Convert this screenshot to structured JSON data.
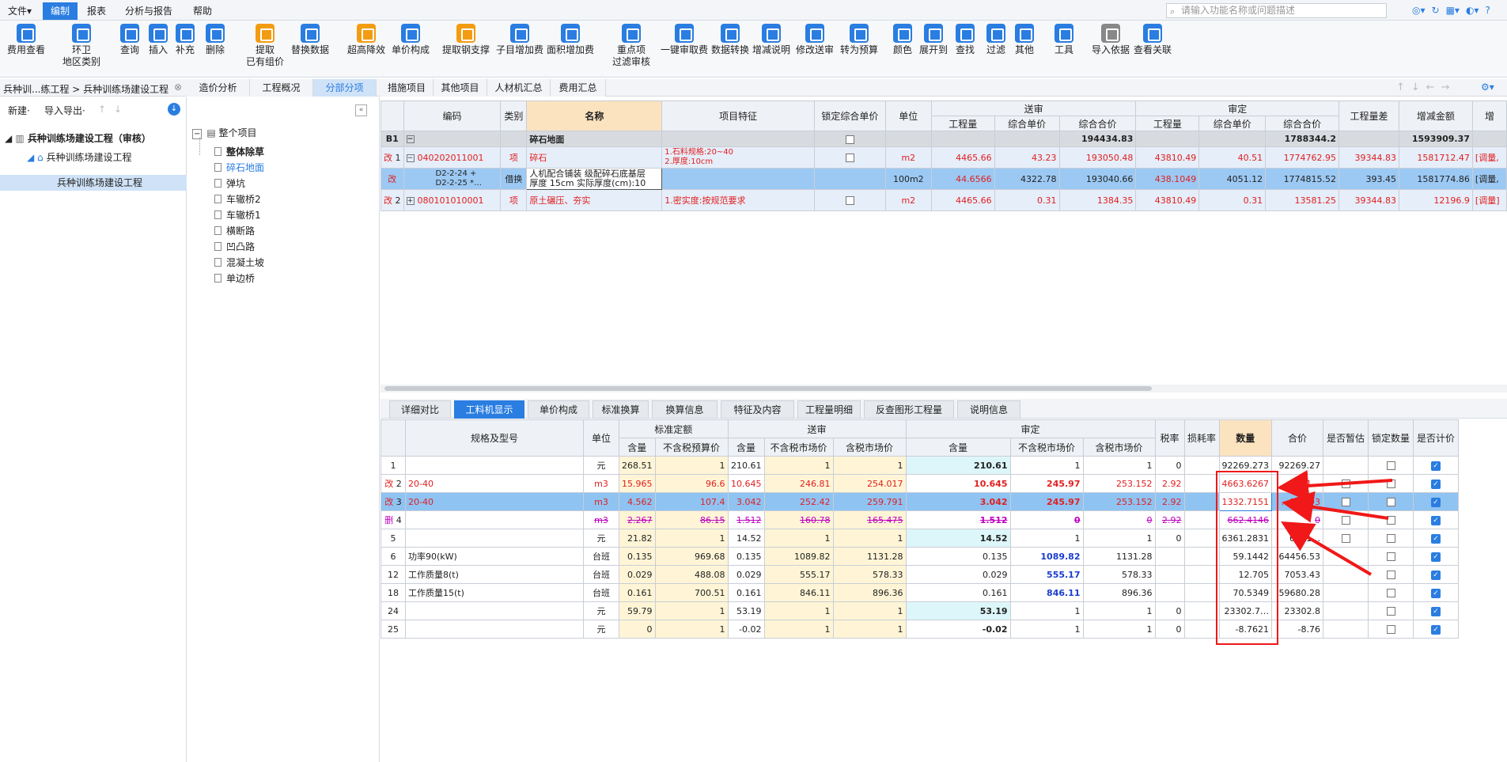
{
  "menubar": {
    "items": [
      "文件",
      "编制",
      "报表",
      "分析与报告",
      "帮助"
    ],
    "search_placeholder": "请输入功能名称或问题描述"
  },
  "ribbon": [
    {
      "label": "费用查看",
      "color": "#2a7de1"
    },
    {
      "label": "环卫",
      "sub": "地区类别",
      "color": "#2a7de1"
    },
    {
      "label": "查询",
      "color": "#2a7de1"
    },
    {
      "label": "插入",
      "color": "#2a7de1"
    },
    {
      "label": "补充",
      "color": "#2a7de1"
    },
    {
      "label": "删除",
      "color": "#2a7de1"
    },
    {
      "label": "提取",
      "sub": "已有组价",
      "color": "#f39c12"
    },
    {
      "label": "替换数据",
      "color": "#2a7de1"
    },
    {
      "label": "超高降效",
      "color": "#f39c12"
    },
    {
      "label": "单价构成",
      "color": "#2a7de1"
    },
    {
      "label": "提取钢支撑",
      "color": "#f39c12"
    },
    {
      "label": "子目增加费",
      "color": "#2a7de1"
    },
    {
      "label": "面积增加费",
      "color": "#2a7de1"
    },
    {
      "label": "重点项",
      "sub": "过滤审核",
      "color": "#2a7de1"
    },
    {
      "label": "一键审取费",
      "color": "#2a7de1"
    },
    {
      "label": "数据转换",
      "color": "#2a7de1"
    },
    {
      "label": "增减说明",
      "color": "#2a7de1"
    },
    {
      "label": "修改送审",
      "color": "#2a7de1"
    },
    {
      "label": "转为预算",
      "color": "#2a7de1"
    },
    {
      "label": "颜色",
      "color": "#2a7de1"
    },
    {
      "label": "展开到",
      "color": "#2a7de1"
    },
    {
      "label": "查找",
      "color": "#2a7de1"
    },
    {
      "label": "过滤",
      "color": "#2a7de1"
    },
    {
      "label": "其他",
      "color": "#2a7de1"
    },
    {
      "label": "工具",
      "color": "#2a7de1"
    },
    {
      "label": "导入依据",
      "color": "#888888"
    },
    {
      "label": "查看关联",
      "color": "#2a7de1"
    }
  ],
  "nav": {
    "breadcrumb": "兵种训...练工程 > 兵种训练场建设工程",
    "tabs": [
      "造价分析",
      "工程概况",
      "分部分项",
      "措施项目",
      "其他项目",
      "人材机汇总",
      "费用汇总"
    ]
  },
  "leftpanel": {
    "new": "新建·",
    "import": "导入导出·",
    "tree": [
      "兵种训练场建设工程（审核）",
      "兵种训练场建设工程",
      "兵种训练场建设工程"
    ]
  },
  "midpanel": {
    "root": "整个项目",
    "items": [
      "整体除草",
      "碎石地面",
      "弹坑",
      "车辙桥2",
      "车辙桥1",
      "横断路",
      "凹凸路",
      "混凝土坡",
      "单边桥"
    ]
  },
  "grid1": {
    "headers": {
      "code": "编码",
      "type": "类别",
      "name": "名称",
      "feature": "项目特征",
      "lock": "锁定综合单价",
      "unit": "单位",
      "sent": "送审",
      "approved": "审定",
      "qty": "工程量",
      "uprice": "综合单价",
      "total": "综合合价",
      "diff": "工程量差",
      "delta": "增减金额",
      "more": "增"
    },
    "b1": {
      "tag": "B1",
      "name": "碎石地面",
      "sent_total": "194434.83",
      "app_total": "1788344.2",
      "delta": "1593909.37"
    },
    "rows": [
      {
        "tag": "改",
        "no": "1",
        "code": "040202011001",
        "type": "项",
        "name": "碎石",
        "feat1": "1.石料规格:20~40",
        "feat2": "2.厚度:10cm",
        "unit": "m2",
        "sq": "4465.66",
        "su": "43.23",
        "st": "193050.48",
        "aq": "43810.49",
        "au": "40.51",
        "at": "1774762.95",
        "dq": "39344.83",
        "delta": "1581712.47",
        "note": "[调量,"
      },
      {
        "tag": "改",
        "code1": "D2-2-24 +",
        "code2": "D2-2-25 *…",
        "type": "借换",
        "name1": "人机配合铺装 级配碎石底基层",
        "name2": "厚度 15cm  实际厚度(cm):10",
        "unit": "100m2",
        "sq": "44.6566",
        "su": "4322.78",
        "st": "193040.66",
        "aq": "438.1049",
        "au": "4051.12",
        "at": "1774815.52",
        "dq": "393.45",
        "delta": "1581774.86",
        "note": "[调量,"
      },
      {
        "tag": "改",
        "no": "2",
        "code": "080101010001",
        "type": "项",
        "name": "原土碾压、夯实",
        "feat1": "1.密实度:按规范要求",
        "unit": "m2",
        "sq": "4465.66",
        "su": "0.31",
        "st": "1384.35",
        "aq": "43810.49",
        "au": "0.31",
        "at": "13581.25",
        "dq": "39344.83",
        "delta": "12196.9",
        "note": "[调量]"
      }
    ]
  },
  "btabs": [
    "详细对比",
    "工料机显示",
    "单价构成",
    "标准换算",
    "换算信息",
    "特征及内容",
    "工程量明细",
    "反查图形工程量",
    "说明信息"
  ],
  "grid2": {
    "headers": {
      "spec": "规格及型号",
      "unit": "单位",
      "std": "标准定额",
      "sent": "送审",
      "app": "审定",
      "content": "含量",
      "notax_budget": "不含税预算价",
      "notax_market": "不含税市场价",
      "tax_market": "含税市场价",
      "rate": "税率",
      "loss": "损耗率",
      "qty": "数量",
      "total": "合价",
      "temp": "是否暂估",
      "lockq": "锁定数量",
      "count": "是否计价"
    },
    "rows": [
      {
        "tag": "",
        "no": "1",
        "spec": "",
        "unit": "元",
        "c1": "268.51",
        "p1": "1",
        "c2": "210.61",
        "p2": "1",
        "p3": "1",
        "c3": "210.61",
        "p4": "1",
        "p5": "1",
        "rate": "0",
        "loss": "",
        "qty": "92269.273",
        "total": "92269.27"
      },
      {
        "tag": "改",
        "no": "2",
        "spec": "20-40",
        "unit": "m3",
        "c1": "15.965",
        "p1": "96.6",
        "c2": "10.645",
        "p2": "246.81",
        "p3": "254.017",
        "c3": "10.645",
        "p4": "245.97",
        "p5": "253.152",
        "rate": "2.92",
        "loss": "",
        "qty": "4663.6267",
        "total": "1…"
      },
      {
        "tag": "改",
        "no": "3",
        "spec": "20-40",
        "unit": "m3",
        "c1": "4.562",
        "p1": "107.4",
        "c2": "3.042",
        "p2": "252.42",
        "p3": "259.791",
        "c3": "3.042",
        "p4": "245.97",
        "p5": "253.152",
        "rate": "2.92",
        "loss": "",
        "qty": "1332.7151",
        "total": "…507.93"
      },
      {
        "tag": "删",
        "no": "4",
        "spec": "",
        "unit": "m3",
        "c1": "2.267",
        "p1": "86.15",
        "c2": "1.512",
        "p2": "160.78",
        "p3": "165.475",
        "c3": "1.512",
        "p4": "0",
        "p5": "0",
        "rate": "2.92",
        "loss": "",
        "qty": "662.4146",
        "total": "0"
      },
      {
        "tag": "",
        "no": "5",
        "spec": "",
        "unit": "元",
        "c1": "21.82",
        "p1": "1",
        "c2": "14.52",
        "p2": "1",
        "p3": "1",
        "c3": "14.52",
        "p4": "1",
        "p5": "1",
        "rate": "0",
        "loss": "",
        "qty": "6361.2831",
        "total": "6361…"
      },
      {
        "tag": "",
        "no": "6",
        "spec": "功率90(kW)",
        "unit": "台班",
        "c1": "0.135",
        "p1": "969.68",
        "c2": "0.135",
        "p2": "1089.82",
        "p3": "1131.28",
        "c3": "0.135",
        "p4": "1089.82",
        "p5": "1131.28",
        "rate": "",
        "loss": "",
        "qty": "59.1442",
        "total": "64456.53"
      },
      {
        "tag": "",
        "no": "12",
        "spec": "工作质量8(t)",
        "unit": "台班",
        "c1": "0.029",
        "p1": "488.08",
        "c2": "0.029",
        "p2": "555.17",
        "p3": "578.33",
        "c3": "0.029",
        "p4": "555.17",
        "p5": "578.33",
        "rate": "",
        "loss": "",
        "qty": "12.705",
        "total": "7053.43"
      },
      {
        "tag": "",
        "no": "18",
        "spec": "工作质量15(t)",
        "unit": "台班",
        "c1": "0.161",
        "p1": "700.51",
        "c2": "0.161",
        "p2": "846.11",
        "p3": "896.36",
        "c3": "0.161",
        "p4": "846.11",
        "p5": "896.36",
        "rate": "",
        "loss": "",
        "qty": "70.5349",
        "total": "59680.28"
      },
      {
        "tag": "",
        "no": "24",
        "spec": "",
        "unit": "元",
        "c1": "59.79",
        "p1": "1",
        "c2": "53.19",
        "p2": "1",
        "p3": "1",
        "c3": "53.19",
        "p4": "1",
        "p5": "1",
        "rate": "0",
        "loss": "",
        "qty": "23302.7…",
        "total": "23302.8"
      },
      {
        "tag": "",
        "no": "25",
        "spec": "",
        "unit": "元",
        "c1": "0",
        "p1": "1",
        "c2": "-0.02",
        "p2": "1",
        "p3": "1",
        "c3": "-0.02",
        "p4": "1",
        "p5": "1",
        "rate": "0",
        "loss": "",
        "qty": "-8.7621",
        "total": "-8.76"
      }
    ]
  }
}
